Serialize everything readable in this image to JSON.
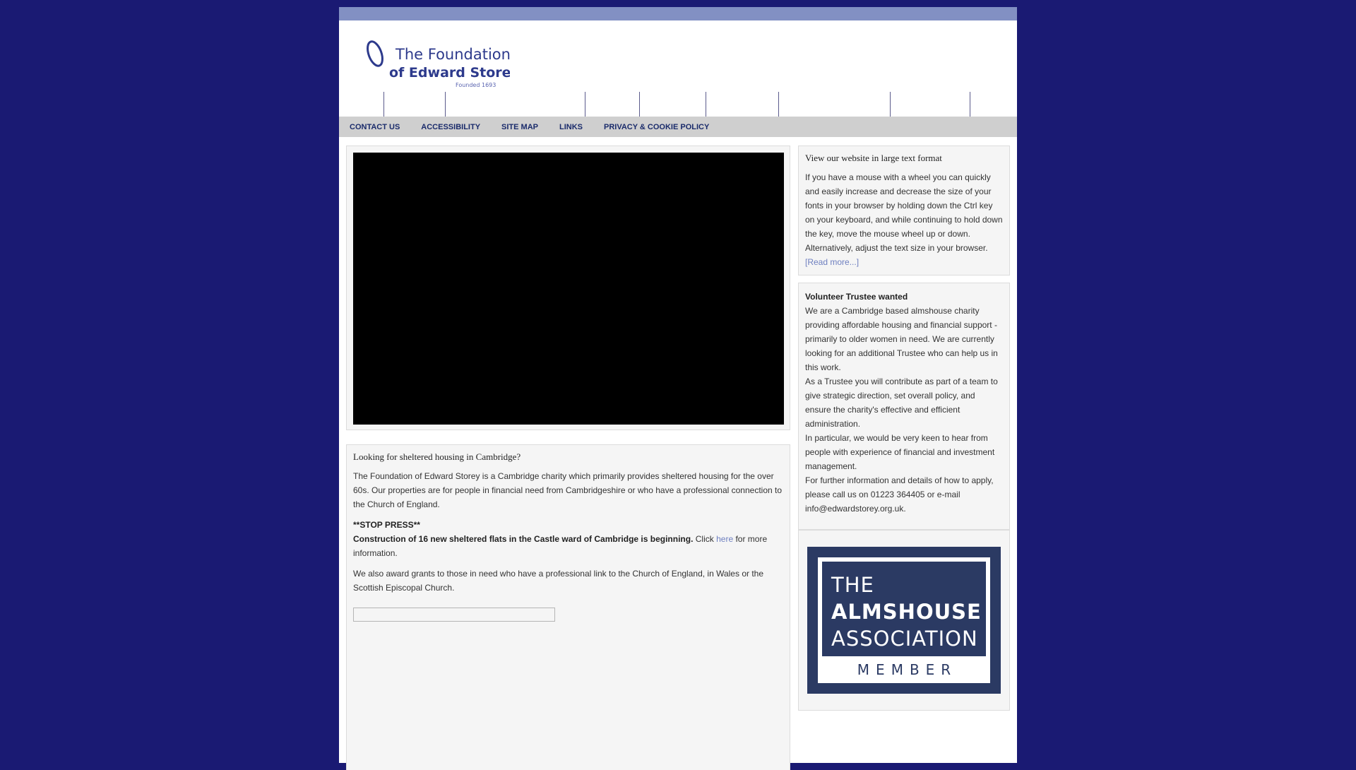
{
  "logo": {
    "line1": "The Foundation",
    "line2": "of Edward Storey",
    "line3": "Founded 1693"
  },
  "subnav": [
    "CONTACT US",
    "ACCESSIBILITY",
    "SITE MAP",
    "LINKS",
    "PRIVACY & COOKIE POLICY"
  ],
  "main": {
    "heading": "Looking for sheltered housing in Cambridge?",
    "intro": "The Foundation of Edward Storey is a Cambridge charity which primarily provides sheltered housing for the over 60s. Our properties are for people in financial need from Cambridgeshire or who have a professional connection to the Church of England.",
    "stop_press": "**STOP PRESS**",
    "construction": "Construction of 16 new sheltered flats in the Castle ward of Cambridge is beginning.",
    "click": "Click",
    "here": "here",
    "more_info": "for more information.",
    "grants": "We also award grants to those in need who have a professional link to the Church of England, in Wales or the Scottish Episcopal Church."
  },
  "sidebar": {
    "large_text": {
      "title": "View our website in large text format",
      "body": "If you have a mouse with a wheel you can quickly and easily increase and decrease the size of your fonts in your browser by holding down the Ctrl key on your keyboard, and while continuing to hold down the key, move the mouse wheel up or down. Alternatively, adjust the text size in your browser.",
      "read_more": "[Read more...]"
    },
    "volunteer": {
      "title": "Volunteer Trustee wanted",
      "p1": "We are a Cambridge based almshouse charity providing affordable housing and financial support - primarily to older women in need. We are currently looking for an additional Trustee who can help us in this work.",
      "p2": "As a Trustee you will contribute as part of a team to give strategic direction, set overall policy, and ensure the charity's effective and efficient administration.",
      "p3": "In particular, we would be very keen to hear from people with experience of financial and investment management.",
      "p4": "For further information and details of how to apply, please call us on 01223 364405 or e-mail info@edwardstorey.org.uk."
    },
    "badge": {
      "line1": "THE",
      "line2": "ALMSHOUSE",
      "line3": "ASSOCIATION",
      "line4": "MEMBER"
    }
  },
  "colors": {
    "background": "#1a1a73",
    "topbar": "#8290c3",
    "link": "#6e7fc0",
    "badge": "#2b3a63"
  }
}
